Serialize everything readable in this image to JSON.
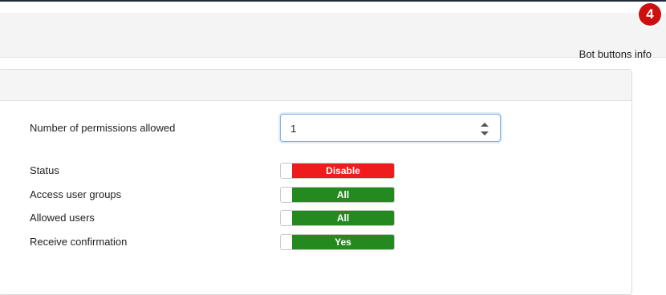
{
  "header": {
    "bot_buttons_info": "Bot buttons info",
    "step_badge": "4"
  },
  "form": {
    "permissions_label": "Number of permissions allowed",
    "permissions_value": "1",
    "status_label": "Status",
    "status_value": "Disable",
    "access_groups_label": "Access user groups",
    "access_groups_value": "All",
    "allowed_users_label": "Allowed users",
    "allowed_users_value": "All",
    "receive_confirmation_label": "Receive confirmation",
    "receive_confirmation_value": "Yes"
  },
  "colors": {
    "disable": "#ee1c1c",
    "enabled": "#248a1f",
    "badge": "#cc1010"
  },
  "icons": {
    "spinner": "up-down-arrows-icon"
  }
}
